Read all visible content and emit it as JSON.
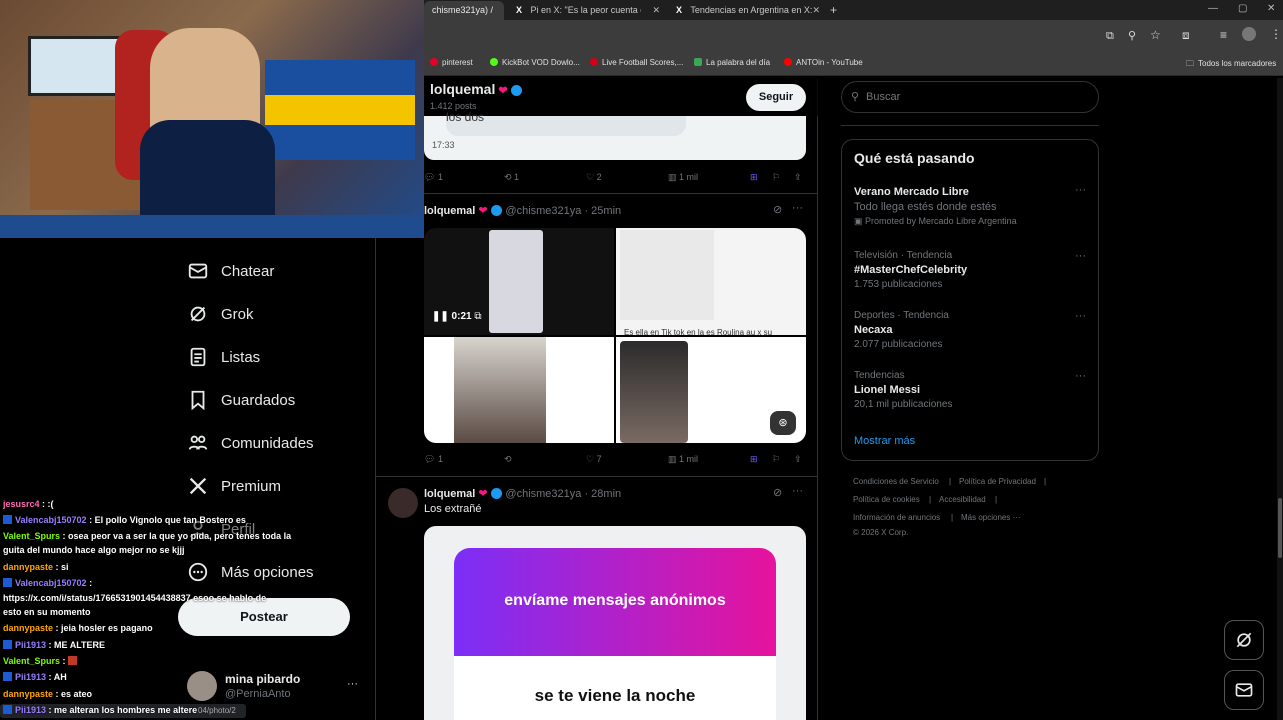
{
  "browser": {
    "tabs": [
      {
        "label": "chisme321ya) /",
        "active": true
      },
      {
        "label": "Pi en X: \"Es la peor cuenta de t\"",
        "active": false
      },
      {
        "label": "Tendencias en Argentina en X:",
        "active": false
      }
    ],
    "new_tab": "+",
    "bookmarks": [
      {
        "label": "pinterest",
        "color": "#e60023"
      },
      {
        "label": "KickBot VOD Dowlo...",
        "color": "#53fc18"
      },
      {
        "label": "Live Football Scores,...",
        "color": "#d2001a"
      },
      {
        "label": "La palabra del día",
        "color": "#3aa757"
      },
      {
        "label": "ANTOin - YouTube",
        "color": "#ff0000"
      }
    ],
    "all_bookmarks": "Todos los marcadores"
  },
  "nav": {
    "items": [
      {
        "label": "Chatear",
        "icon": "mail-icon"
      },
      {
        "label": "Grok",
        "icon": "grok-icon"
      },
      {
        "label": "Listas",
        "icon": "list-icon"
      },
      {
        "label": "Guardados",
        "icon": "bookmark-icon"
      },
      {
        "label": "Comunidades",
        "icon": "communities-icon"
      },
      {
        "label": "Premium",
        "icon": "x-logo-icon"
      },
      {
        "label": "Perfil",
        "icon": "profile-icon"
      },
      {
        "label": "Más opciones",
        "icon": "more-circle-icon"
      }
    ],
    "post_button": "Postear",
    "account": {
      "name": "mina pibardo",
      "handle": "@PerniaAnto",
      "more": "···"
    }
  },
  "chat": [
    {
      "user": "jesusrc4",
      "color": "#ff69b4",
      "text": ": :(",
      "sub": false
    },
    {
      "user": "Valencabj150702",
      "color": "#9b7cff",
      "text": ": El pollo Vignolo que tan Bostero es",
      "sub": true
    },
    {
      "user": "Valent_Spurs",
      "color": "#7cfc00",
      "text": ": osea peor va a ser la que yo pida, pero tenes toda la",
      "sub": false
    },
    {
      "user": "",
      "color": "#ffffff",
      "text": "guita del mundo hace algo mejor no se kjjj",
      "sub": false
    },
    {
      "user": "dannypaste",
      "color": "#ffa500",
      "text": ": si",
      "sub": false
    },
    {
      "user": "Valencabj150702",
      "color": "#9b7cff",
      "text": ":",
      "sub": true
    },
    {
      "user": "",
      "color": "#ffffff",
      "text": "https://x.com/i/status/1766531901454438837 esoo se hablo de",
      "sub": false
    },
    {
      "user": "",
      "color": "#ffffff",
      "text": "esto en su momento",
      "sub": false
    },
    {
      "user": "dannypaste",
      "color": "#ffa500",
      "text": ": jeia hosler es pagano",
      "sub": false
    },
    {
      "user": "Pii1913",
      "color": "#9b7cff",
      "text": ": ME ALTERE",
      "sub": true
    },
    {
      "user": "Valent_Spurs",
      "color": "#7cfc00",
      "text": ":",
      "sub": false
    },
    {
      "user": "Pii1913",
      "color": "#9b7cff",
      "text": ": AH",
      "sub": true
    },
    {
      "user": "dannypaste",
      "color": "#ffa500",
      "text": ": es ateo",
      "sub": false
    },
    {
      "user": "Pii1913",
      "color": "#9b7cff",
      "text": ": me alteran los hombres me altere",
      "sub": true
    }
  ],
  "status_url": "04/photo/2",
  "profile_header": {
    "name": "lolquemal",
    "posts": "1.412 posts",
    "follow": "Seguir"
  },
  "tweets": [
    {
      "partial_text": "los dos",
      "time": "17:33",
      "actions": {
        "replies": "1",
        "reposts": "1",
        "likes": "2",
        "views": "1 mil"
      }
    },
    {
      "name": "lolquemal",
      "handle": "@chisme321ya",
      "age": "· 25min",
      "video_time": "0:21",
      "caption_in_image": "Es ella en Tik tok en la es Roulina au x su",
      "actions": {
        "replies": "1",
        "reposts": "",
        "likes": "7",
        "views": "1 mil"
      }
    },
    {
      "name": "lolquemal",
      "handle": "@chisme321ya",
      "age": "· 28min",
      "text": "Los extrañé",
      "card_title": "envíame mensajes anónimos",
      "card_body": "se te viene la noche"
    }
  ],
  "right": {
    "search_placeholder": "Buscar",
    "trending_title": "Qué está pasando",
    "trends": [
      {
        "category": "",
        "title": "Verano Mercado Libre",
        "subtitle": "Todo llega estés donde estés",
        "count": "Promoted by Mercado Libre Argentina"
      },
      {
        "category": "Televisión · Tendencia",
        "title": "#MasterChefCelebrity",
        "subtitle": "",
        "count": "1.753 publicaciones"
      },
      {
        "category": "Deportes · Tendencia",
        "title": "Necaxa",
        "subtitle": "",
        "count": "2.077 publicaciones"
      },
      {
        "category": "Tendencias",
        "title": "Lionel Messi",
        "subtitle": "",
        "count": "20,1 mil publicaciones"
      }
    ],
    "show_more": "Mostrar más",
    "footer": [
      "Condiciones de Servicio",
      "|",
      "Política de Privacidad",
      "|",
      "Política de cookies",
      "|",
      "Accesibilidad",
      "|",
      "Información de anuncios",
      "|",
      "Más opciones ···",
      "© 2026 X Corp."
    ]
  },
  "colors": {
    "accent": "#1d9bf0",
    "verified": "#1d9bf0",
    "bookmark_active": "#7856ff",
    "card_gradient_start": "#7b2ff7",
    "card_gradient_end": "#e6139c"
  }
}
